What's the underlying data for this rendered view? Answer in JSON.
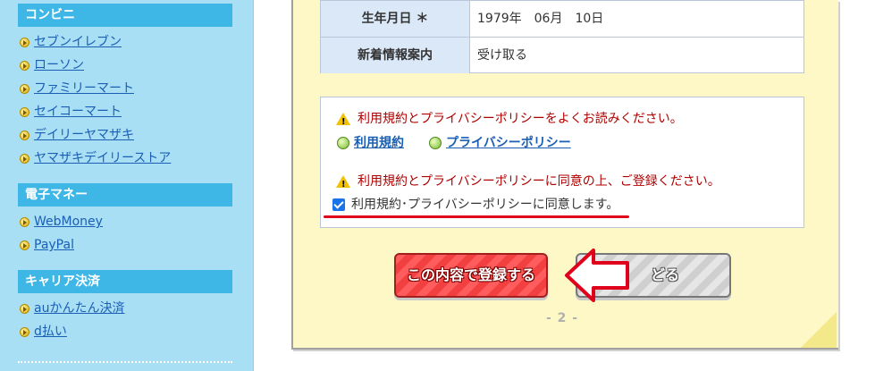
{
  "sidebar": {
    "sections": [
      {
        "title": "コンビニ",
        "items": [
          "セブンイレブン",
          "ローソン",
          "ファミリーマート",
          "セイコーマート",
          "デイリーヤマザキ",
          "ヤマザキデイリーストア"
        ]
      },
      {
        "title": "電子マネー",
        "items": [
          "WebMoney",
          "PayPal"
        ]
      },
      {
        "title": "キャリア決済",
        "items": [
          "auかんたん決済",
          "d払い"
        ]
      }
    ]
  },
  "profile_table": {
    "rows": [
      {
        "label": "生年月日 ＊",
        "value": "1979年　06月　10日"
      },
      {
        "label": "新着情報案内",
        "value": "受け取る"
      }
    ]
  },
  "terms": {
    "notice_read": "利用規約とプライバシーポリシーをよくお読みください。",
    "link_terms": "利用規約",
    "link_privacy": "プライバシーポリシー",
    "notice_agree": "利用規約とプライバシーポリシーに同意の上、ご登録ください。",
    "checkbox_label": "利用規約･プライバシーポリシーに同意します。",
    "checkbox_checked": true
  },
  "buttons": {
    "register": "この内容で登録する",
    "back": "どる"
  },
  "page_number": "- 2 -",
  "colors": {
    "sidebar_bg": "#a9dff5",
    "section_header": "#3fb7e6",
    "panel_bg": "#fdf8c6",
    "register_button": "#f24040",
    "annotation_red": "#e0001b"
  }
}
